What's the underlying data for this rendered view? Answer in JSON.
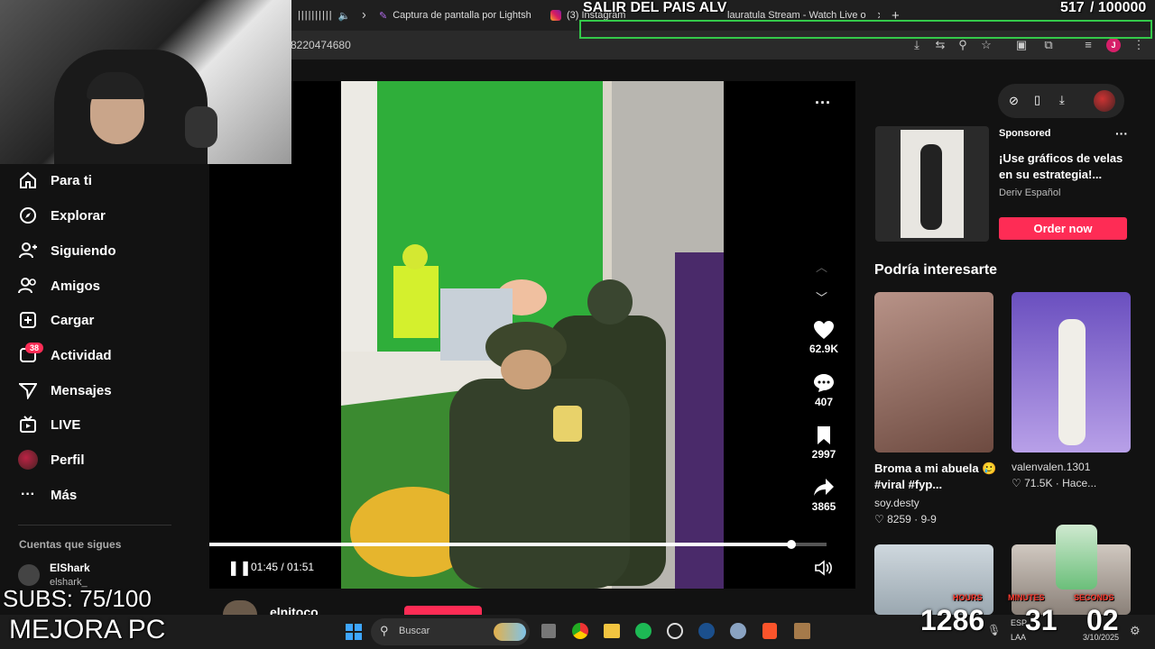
{
  "browser": {
    "tabs": [
      {
        "label": "Captura de pantalla por Lightsh"
      },
      {
        "label": "(3) Instagram"
      },
      {
        "label": "lauratula Stream - Watch Live o"
      }
    ],
    "new_tab": "+",
    "address": "8220474680",
    "profile_initial": "J"
  },
  "sidebar": {
    "items": [
      {
        "label": "Para ti",
        "icon": "home-icon"
      },
      {
        "label": "Explorar",
        "icon": "compass-icon"
      },
      {
        "label": "Siguiendo",
        "icon": "following-icon"
      },
      {
        "label": "Amigos",
        "icon": "friends-icon"
      },
      {
        "label": "Cargar",
        "icon": "upload-icon"
      },
      {
        "label": "Actividad",
        "icon": "inbox-icon"
      },
      {
        "label": "Mensajes",
        "icon": "send-icon"
      },
      {
        "label": "LIVE",
        "icon": "live-icon"
      },
      {
        "label": "Perfil",
        "icon": "avatar"
      },
      {
        "label": "Más",
        "icon": "more-icon"
      }
    ],
    "activity_badge": "38",
    "following_title": "Cuentas que sigues",
    "account_name": "ElShark",
    "account_handle": "elshark_"
  },
  "video": {
    "time": "01:45 / 01:51",
    "progress": 0.943,
    "author": "elnitoco",
    "likes": "62.9K",
    "comments": "407",
    "saves": "2997",
    "shares": "3865"
  },
  "ad": {
    "sponsored": "Sponsored",
    "title": "¡Use gráficos de velas en su estrategia!...",
    "advertiser": "Deriv Español",
    "cta": "Order now"
  },
  "suggestions": {
    "title": "Podría interesarte",
    "items": [
      {
        "title": "Broma a mi abuela 🥲 #viral #fyp...",
        "author": "soy.desty",
        "likes": "8259",
        "date": "9-9"
      },
      {
        "title": "valenvalen.1301",
        "author": "",
        "likes": "71.5K",
        "date": "Hace..."
      }
    ]
  },
  "overlay": {
    "goal_title": "SALIR DEL PAIS ALV",
    "goal_count": "517",
    "goal_total": "/ 100000",
    "subs": "SUBS: 75/100",
    "mejora": "MEJORA PC",
    "timer_hours": "1286",
    "timer_minutes": "31",
    "timer_seconds": "02",
    "timer_label_h": "HOURS",
    "timer_label_m": "MINUTES",
    "timer_label_s": "SECONDS"
  },
  "taskbar": {
    "search": "Buscar",
    "lang": "ESP",
    "lang2": "LAA",
    "date": "3/10/2025"
  },
  "colors": {
    "accent": "#fe2c55",
    "goal_border": "#34c94a"
  }
}
